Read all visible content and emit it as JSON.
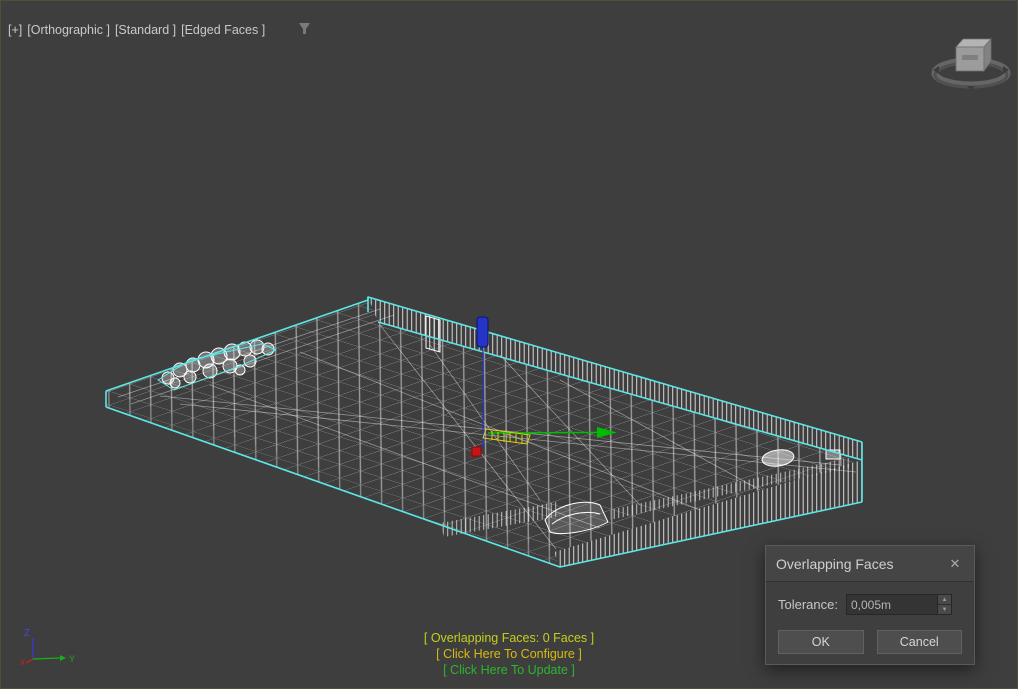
{
  "viewport_label": {
    "segments": [
      "[+]",
      "[Orthographic ]",
      "[Standard ]",
      "[Edged Faces ]"
    ]
  },
  "xview": {
    "lines": [
      "[ Overlapping Faces: 0 Faces ]",
      "[ Click Here To Configure ]",
      "[ Click Here To Update ]"
    ]
  },
  "dialog": {
    "title": "Overlapping Faces",
    "close_icon": "✕",
    "tolerance_label": "Tolerance:",
    "tolerance_value": "0,005m",
    "spinner_up": "▲",
    "spinner_down": "▼",
    "ok_label": "OK",
    "cancel_label": "Cancel"
  },
  "axis_tripod": {
    "z_label": "Z",
    "x_label": "x",
    "y_label": "Y"
  },
  "colors": {
    "selection_outline": "#5ce6e6",
    "wireframe": "#ffffff",
    "xview_line1": "#c6ce1d",
    "xview_line2": "#d8ba12",
    "xview_line3": "#2eb52e",
    "gizmo_x": "#c81414",
    "gizmo_y": "#00bd00",
    "gizmo_z": "#2433c8",
    "gizmo_plane": "#d8d40a"
  }
}
